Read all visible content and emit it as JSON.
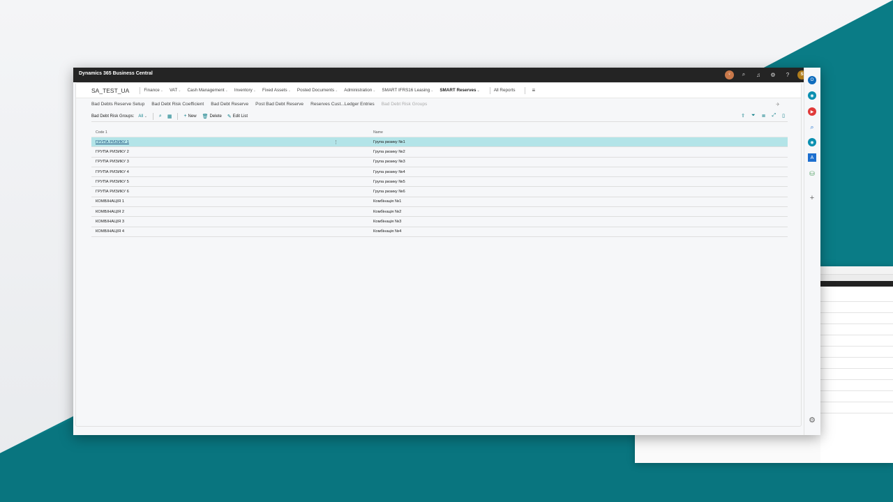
{
  "app": {
    "title": "Dynamics 365 Business Central"
  },
  "titlebar_icons": [
    {
      "name": "user-orange-avatar",
      "glyph": "♀"
    },
    {
      "name": "search-icon",
      "glyph": "⌕"
    },
    {
      "name": "bell-icon",
      "glyph": "🔔"
    },
    {
      "name": "settings-icon",
      "glyph": "⚙"
    },
    {
      "name": "help-icon",
      "glyph": "?"
    },
    {
      "name": "user-avatar",
      "glyph": "S"
    }
  ],
  "nav": {
    "company": "SA_TEST_UA",
    "items": [
      "Finance",
      "VAT",
      "Cash Management",
      "Inventory",
      "Fixed Assets",
      "Posted Documents",
      "Administration",
      "SMART IFRS16 Leasing",
      "SMART Reserves"
    ],
    "all_reports": "All Reports"
  },
  "actions": [
    "Bad Debts Reserve Setup",
    "Bad Debt Risk Coefficient",
    "Bad Debt Reserve",
    "Post Bad Debt Reserve",
    "Reserves Cust...Ledger Entries",
    "Bad Debt Risk Groups"
  ],
  "toolbar": {
    "label": "Bad Debt Risk Groups:",
    "filter": "All",
    "new": "New",
    "delete": "Delete",
    "edit_list": "Edit List"
  },
  "grid": {
    "headers": [
      "Code 1",
      "Name"
    ],
    "rows": [
      [
        "ГРУПА РИЗИКУ 1",
        "Група ризику №1"
      ],
      [
        "ГРУПА РИЗИКУ 2",
        "Група ризику №2"
      ],
      [
        "ГРУПА РИЗИКУ 3",
        "Група ризику №3"
      ],
      [
        "ГРУПА РИЗИКУ 4",
        "Група ризику №4"
      ],
      [
        "ГРУПА РИЗИКУ 5",
        "Група ризику №5"
      ],
      [
        "ГРУПА РИЗИКУ 6",
        "Група ризику №6"
      ],
      [
        "КОМБІНАЦІЯ 1",
        "Комбінація №1"
      ],
      [
        "КОМБІНАЦІЯ 2",
        "Комбінація №2"
      ],
      [
        "КОМБІНАЦІЯ 3",
        "Комбінація №3"
      ],
      [
        "КОМБІНАЦІЯ 4",
        "Комбінація №4"
      ]
    ]
  },
  "colors": {
    "accent": "#0a7c86",
    "selected_row": "#b3e4e8",
    "titlebar": "#242424"
  }
}
